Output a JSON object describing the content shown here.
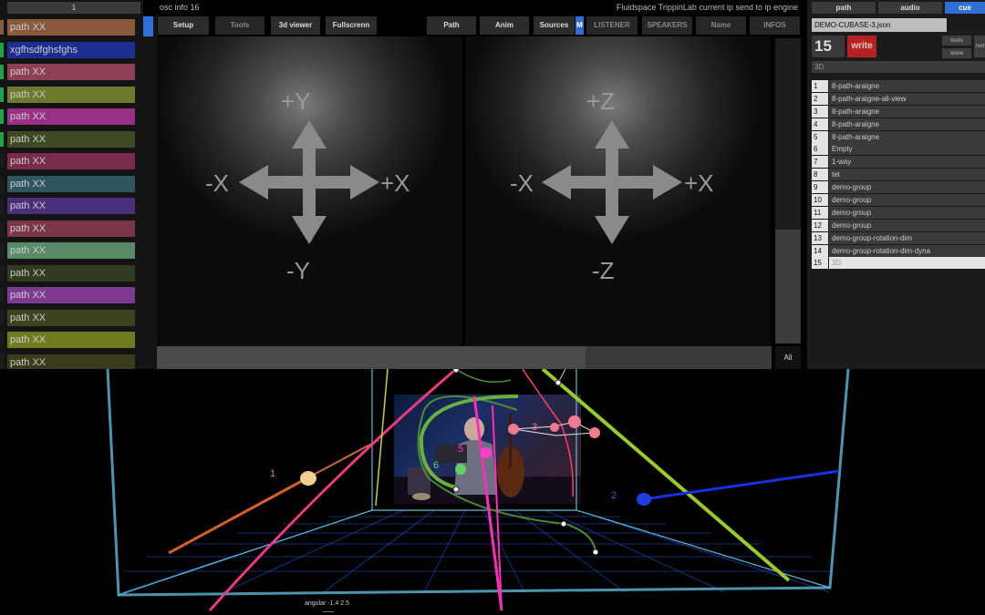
{
  "left_panel": {
    "header_label": "1",
    "paths": [
      {
        "label": "path XX",
        "color": "#8a5a3e",
        "marker": "#8a5a3e"
      },
      {
        "label": "xgfhsdfghsfghs",
        "color": "#1a2f8f",
        "marker": "#1fa34a"
      },
      {
        "label": "path XX",
        "color": "#8f3f55",
        "marker": "#1fa34a"
      },
      {
        "label": "path XX",
        "color": "#6c7a2e",
        "marker": "#1fa34a"
      },
      {
        "label": "path XX",
        "color": "#9a2f86",
        "marker": "#1fa34a"
      },
      {
        "label": "path XX",
        "color": "#3d4a22",
        "marker": "#1fa34a"
      },
      {
        "label": "path XX",
        "color": "#7a2a4a",
        "marker": "#1b1b1b"
      },
      {
        "label": "path XX",
        "color": "#2f5561",
        "marker": "#1b1b1b"
      },
      {
        "label": "path XX",
        "color": "#4a2f7a",
        "marker": "#1b1b1b"
      },
      {
        "label": "path XX",
        "color": "#7a3548",
        "marker": "#1b1b1b"
      },
      {
        "label": "path XX",
        "color": "#5a8a6a",
        "marker": "#1b1b1b"
      },
      {
        "label": "path XX",
        "color": "#2f3a1e",
        "marker": "#1b1b1b"
      },
      {
        "label": "path XX",
        "color": "#7e3a8f",
        "marker": "#1b1b1b"
      },
      {
        "label": "path XX",
        "color": "#3f421e",
        "marker": "#1b1b1b"
      },
      {
        "label": "path XX",
        "color": "#6f7a1f",
        "marker": "#1b1b1b"
      },
      {
        "label": "path XX",
        "color": "#3a3a1c",
        "marker": "#1b1b1b"
      }
    ]
  },
  "top_bar": {
    "osc_info": "osc info 16",
    "engine_info": "Fluidspace TrippinLab current ip send to ip engine"
  },
  "tabs": {
    "setup": "Setup",
    "tools": "Tools",
    "viewer3d": "3d viewer",
    "fullscreen": "Fullscrenn",
    "path": "Path",
    "anim": "Anim",
    "sources": "Sources",
    "m": "M",
    "listener": "LISTENER",
    "speakers": "SPEAKERS",
    "name": "Name",
    "infos": "INFOS"
  },
  "viewers": {
    "left": {
      "top": "+Y",
      "bottom": "-Y",
      "left": "-X",
      "right": "+X"
    },
    "right": {
      "top": "+Z",
      "bottom": "-Z",
      "left": "-X",
      "right": "+X"
    },
    "all_label": "All"
  },
  "right_panel": {
    "tabs": {
      "path": "path",
      "audio": "audio",
      "cue": "cue"
    },
    "file_name": "DEMO-CUBASE-3.json",
    "cue_number": "15",
    "write_label": "write",
    "tools_label": "tools",
    "store_label": "store",
    "rem_label": "rem",
    "cue_name": "3D",
    "cues": [
      {
        "num": "1",
        "name": "8-path-araigne"
      },
      {
        "num": "2",
        "name": "8-path-araigne-all-view"
      },
      {
        "num": "3",
        "name": "8-path-araigne"
      },
      {
        "num": "4",
        "name": "8-path-araigne"
      },
      {
        "num": "5",
        "name": "8-path-araigne"
      },
      {
        "num": "6",
        "name": "Empty"
      },
      {
        "num": "7",
        "name": "1-way"
      },
      {
        "num": "8",
        "name": "tet"
      },
      {
        "num": "9",
        "name": "demo-group"
      },
      {
        "num": "10",
        "name": "demo-group"
      },
      {
        "num": "11",
        "name": "demo-group"
      },
      {
        "num": "12",
        "name": "demo-group"
      },
      {
        "num": "13",
        "name": "demo-group-rotation-dim"
      },
      {
        "num": "14",
        "name": "demo-group-rotation-dim-dyna"
      },
      {
        "num": "15",
        "name": "3D",
        "selected": true
      }
    ]
  },
  "scene": {
    "angular": "angular -1.4 2.5",
    "sources": [
      {
        "label": "1",
        "color": "#f0d090"
      },
      {
        "label": "2",
        "color": "#1f3de0"
      },
      {
        "label": "3",
        "color": "#f07a90"
      },
      {
        "label": "5",
        "color": "#ff3fd0"
      },
      {
        "label": "6",
        "color": "#5fd06a"
      }
    ]
  }
}
